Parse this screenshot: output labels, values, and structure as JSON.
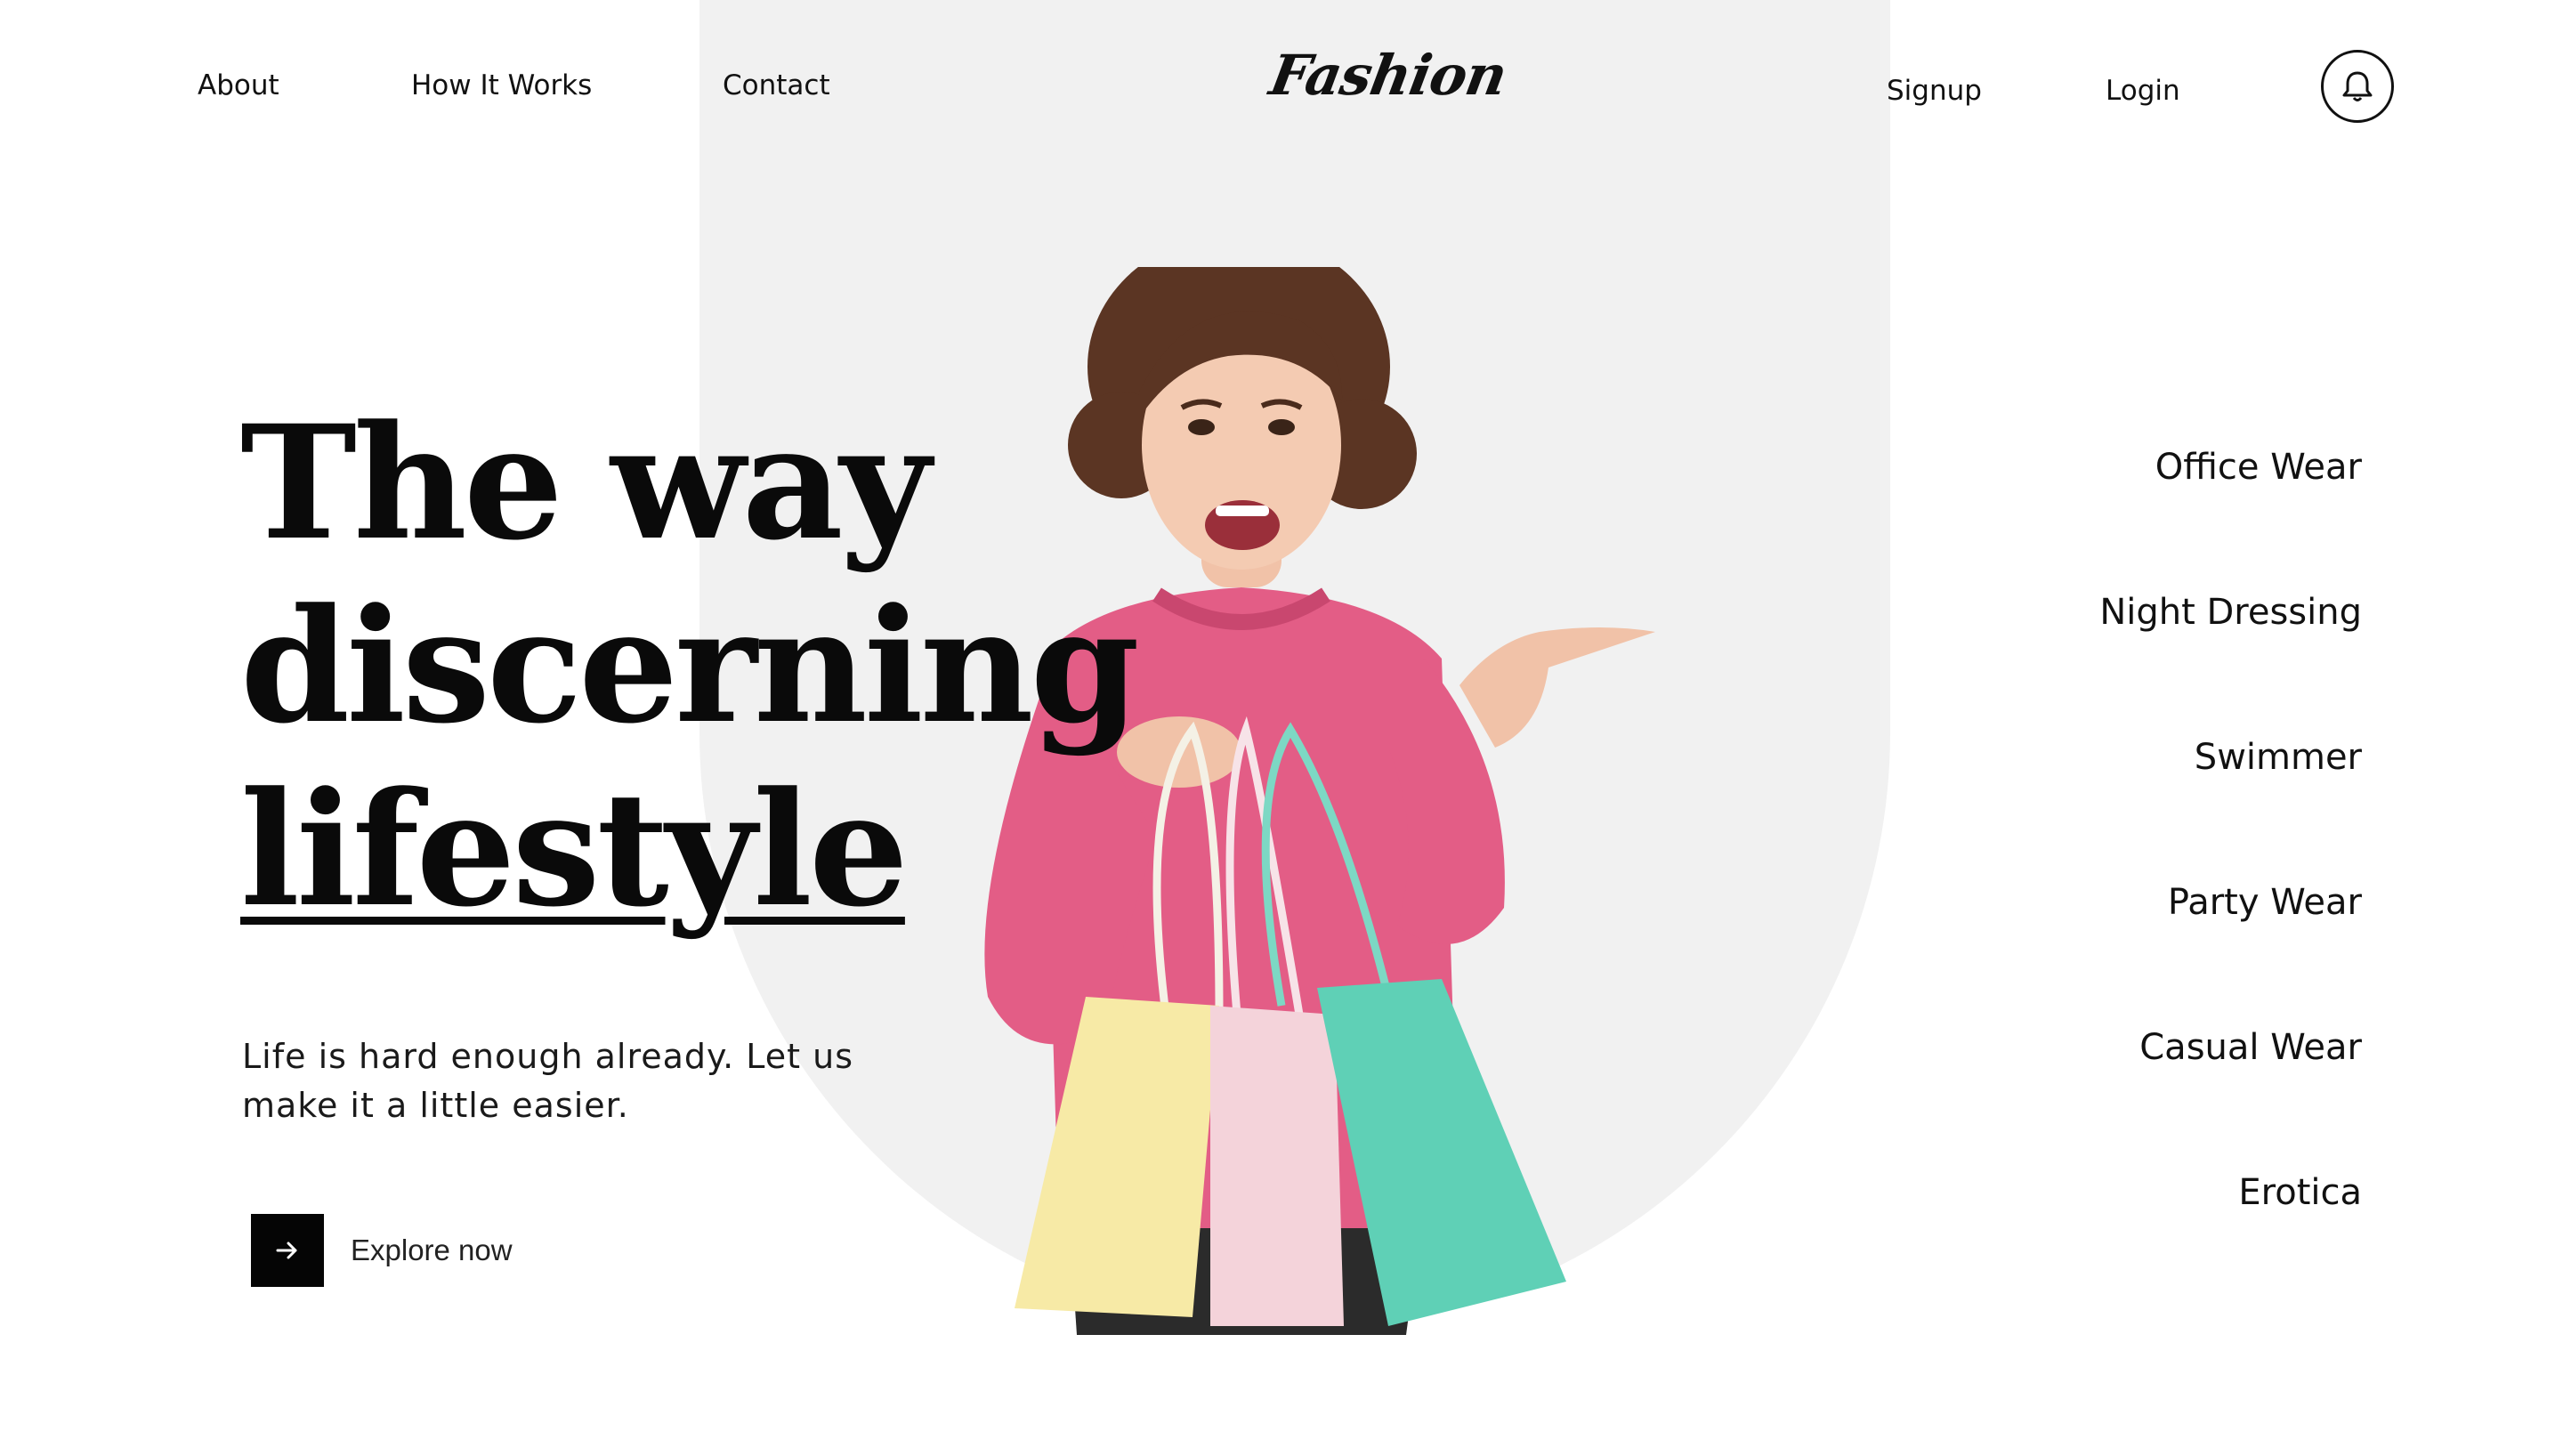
{
  "nav": {
    "about": "About",
    "how_it_works": "How It Works",
    "contact": "Contact",
    "logo": "Fashion",
    "signup": "Signup",
    "login": "Login",
    "bell_icon": "bell-icon"
  },
  "hero": {
    "headline_line1": "The way",
    "headline_line2": "discerning",
    "headline_line3": "lifestyle",
    "subtext": "Life is hard enough already. Let us make it a little easier.",
    "cta_label": "Explore now",
    "cta_icon": "arrow-right-icon"
  },
  "categories": [
    {
      "label": "Office Wear"
    },
    {
      "label": "Night Dressing"
    },
    {
      "label": "Swimmer"
    },
    {
      "label": "Party Wear"
    },
    {
      "label": "Casual Wear"
    },
    {
      "label": "Erotica"
    }
  ],
  "colors": {
    "background": "#ffffff",
    "arch": "#f1f1f1",
    "text": "#111111",
    "sweater": "#e35d86",
    "bag_yellow": "#f7eaa6",
    "bag_pink": "#f4d3da",
    "bag_teal": "#5fd0b6"
  }
}
